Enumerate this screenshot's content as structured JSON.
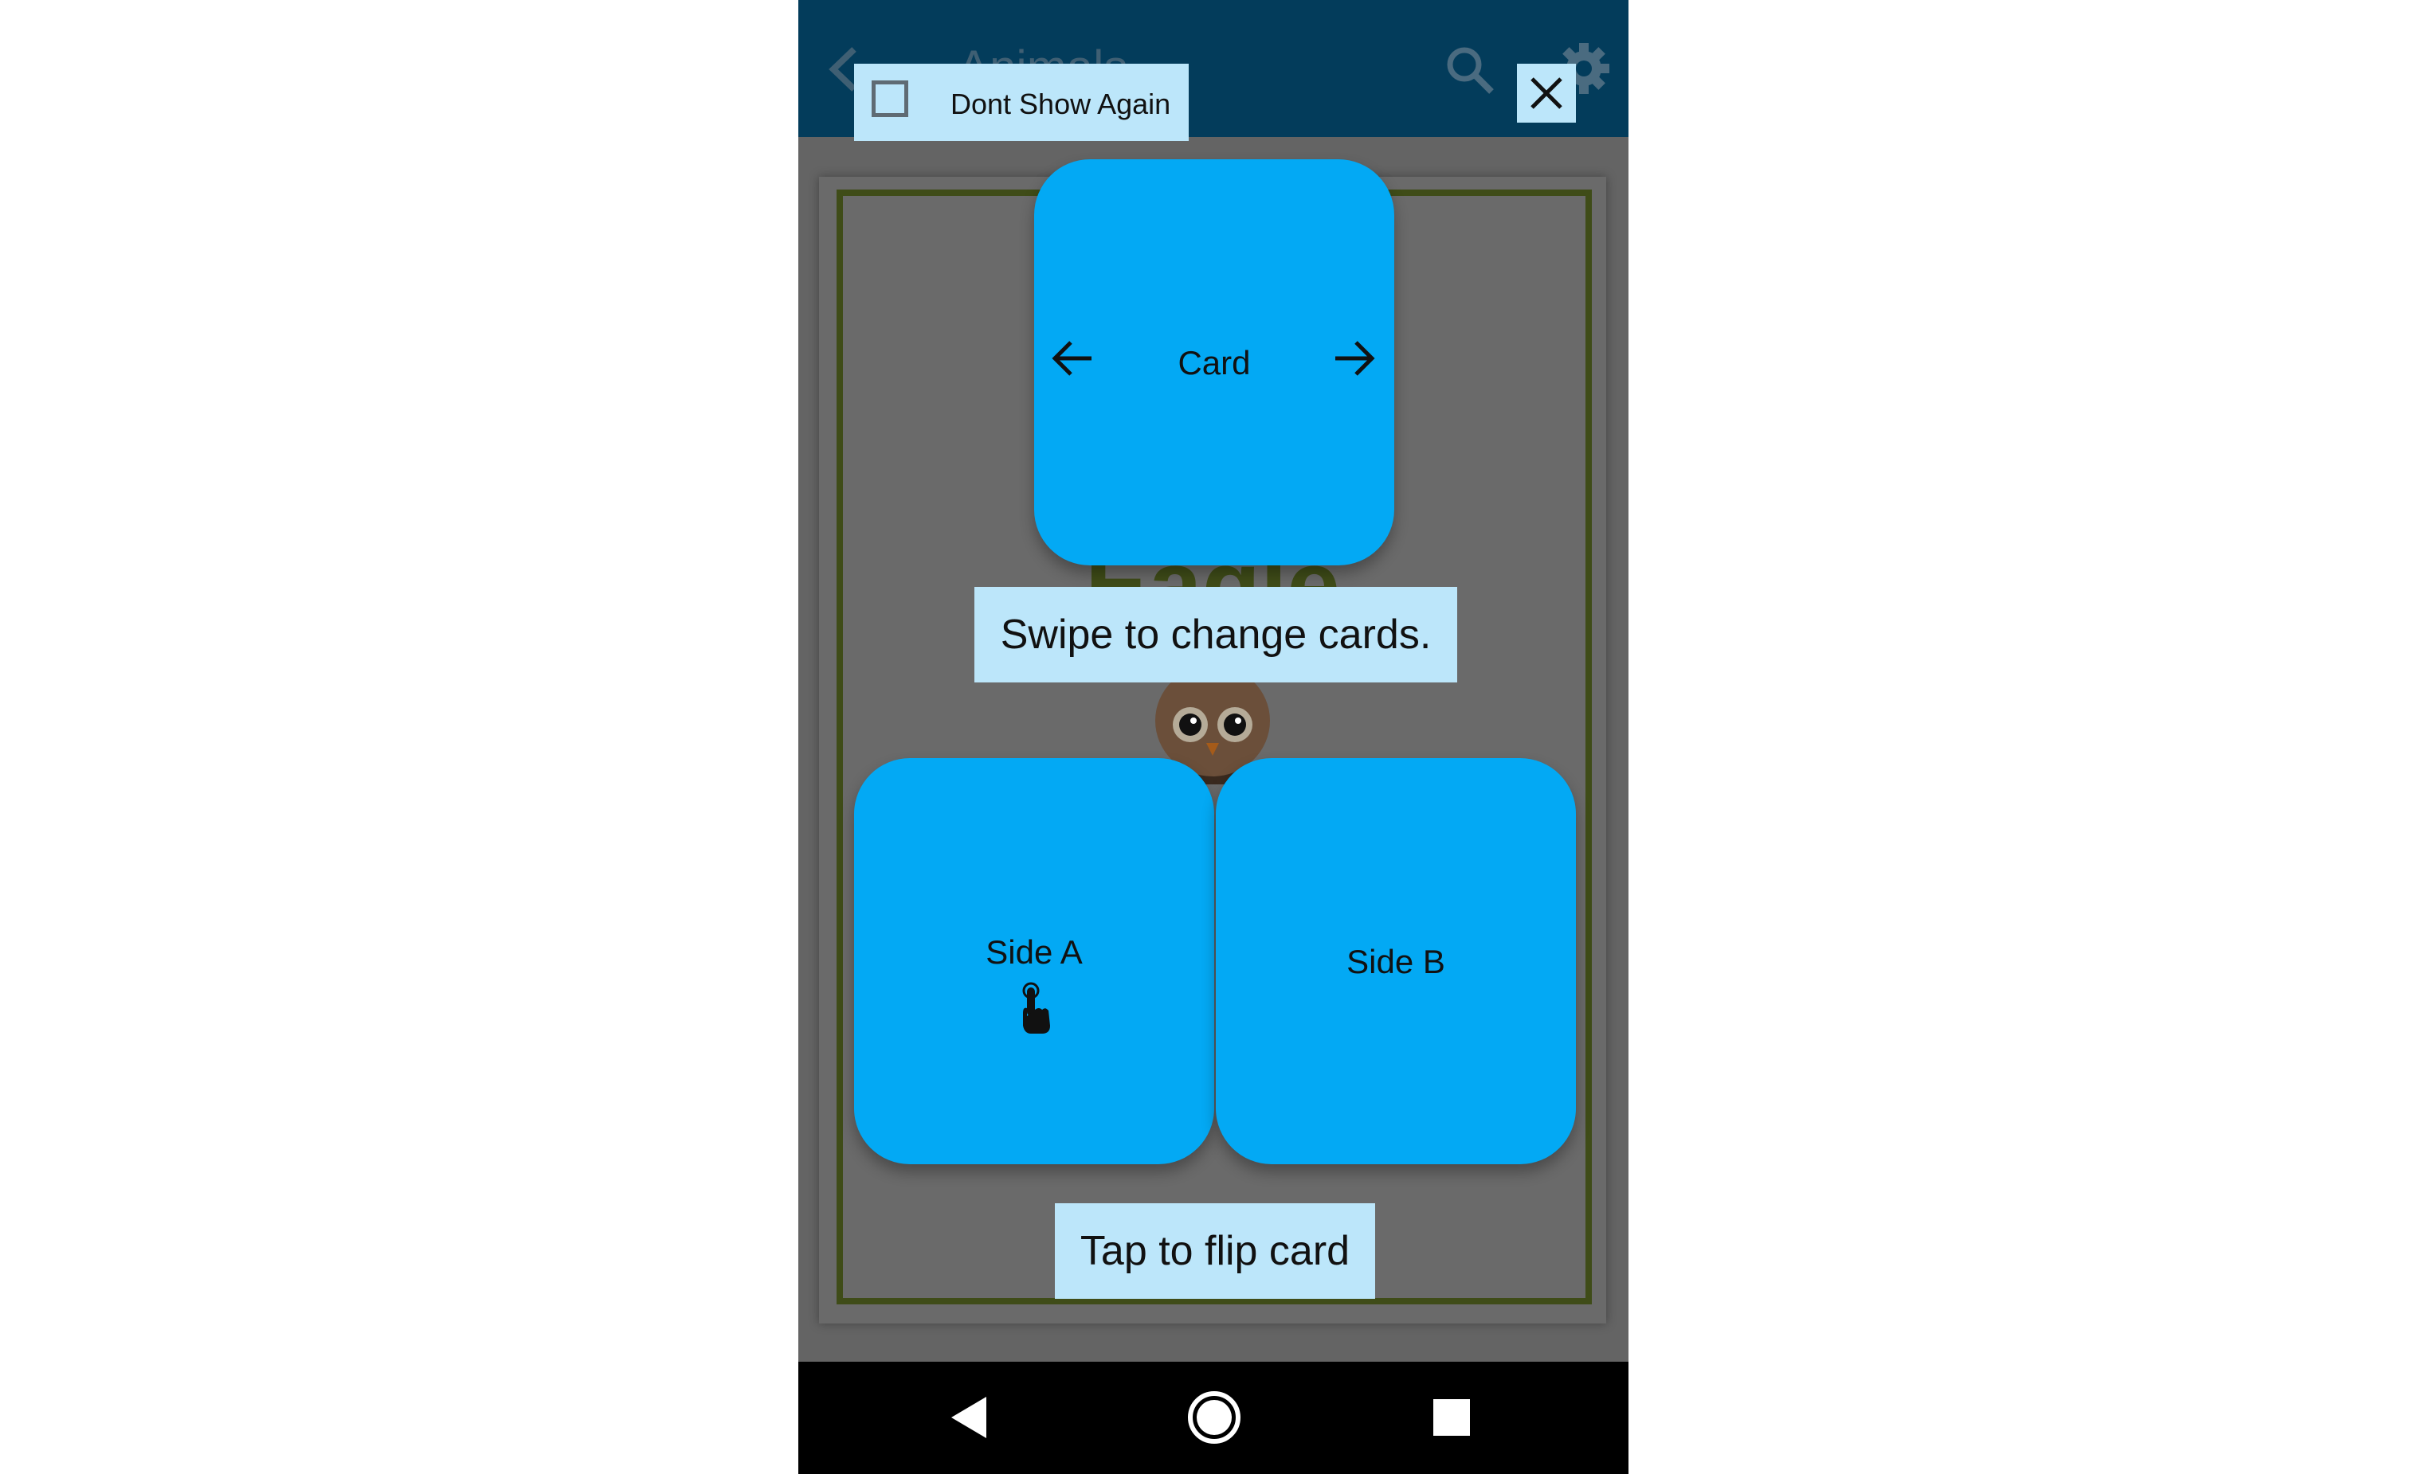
{
  "app": {
    "title": "Animals",
    "background_word": "Eagle"
  },
  "overlay": {
    "dont_show_again_label": "Dont Show Again",
    "dont_show_again_checked": false,
    "card_tile_label": "Card",
    "side_a_label": "Side A",
    "side_b_label": "Side B",
    "swipe_hint": "Swipe to change cards.",
    "tap_hint": "Tap to flip card"
  },
  "icons": {
    "toolbar": [
      "arrow-back-icon",
      "search-icon",
      "gear-icon",
      "close-icon"
    ],
    "tiles": [
      "arrow-left-icon",
      "arrow-right-icon",
      "tap-hand-icon"
    ],
    "nav": [
      "nav-back-icon",
      "nav-home-icon",
      "nav-recent-icon"
    ]
  },
  "colors": {
    "appbar": "#033c5b",
    "tile": "#03a9f4",
    "tip_background": "#bce6fa",
    "frame": "#3f4c18",
    "navbar": "#000000"
  }
}
